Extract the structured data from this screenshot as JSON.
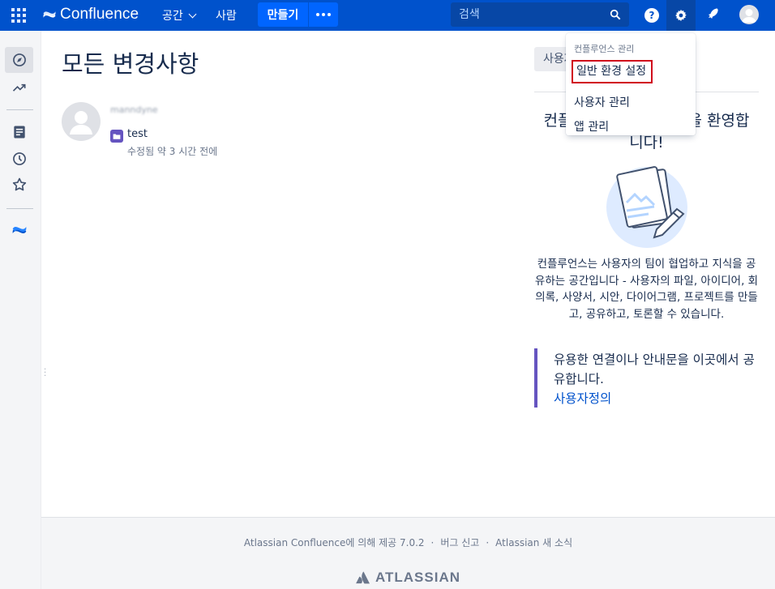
{
  "header": {
    "logo_text": "Confluence",
    "spaces_label": "공간",
    "people_label": "사람",
    "create_label": "만들기",
    "search_placeholder": "검색",
    "help_symbol": "?",
    "brand_color": "#0052cc"
  },
  "main": {
    "title": "모든 변경사항",
    "feed": [
      {
        "user": "manndyne",
        "page": "test",
        "meta": "수정됨 약 3 시간 전에"
      }
    ]
  },
  "right_panel": {
    "button_label": "사용자",
    "welcome_title": "컨플루언스 팀 스페이스에 오신 것을 환영합니다!",
    "welcome_visible_start": "컨플",
    "welcome_visible_end": "을 환영합",
    "welcome_line2": "니다!",
    "description": "컨플루언스는 사용자의 팀이 협업하고 지식을 공유하는 공간입니다 - 사용자의 파일, 아이디어, 회의록, 사양서, 시안, 다이어그램, 프로젝트를 만들고, 공유하고, 토론할 수 있습니다.",
    "info_text": "유용한 연결이나 안내문을 이곳에서 공유합니다.",
    "info_link": "사용자정의",
    "accent_color": "#6554c0"
  },
  "admin_menu": {
    "heading": "컨플루언스 관리",
    "items": [
      {
        "label": "일반 환경 설정",
        "highlighted": true
      },
      {
        "label": "사용자 관리",
        "highlighted": false
      },
      {
        "label": "앱 관리",
        "highlighted": false
      }
    ]
  },
  "sidebar": {
    "items": [
      "compass-icon",
      "chart-icon",
      "feed-icon",
      "clock-icon",
      "star-icon",
      "confluence-logo-icon"
    ]
  },
  "footer": {
    "powered_by": "Atlassian Confluence에 의해 제공 7.0.2",
    "report_bug": "버그 신고",
    "news": "Atlassian 새 소식",
    "separator": "·",
    "logo_text": "ATLASSIAN"
  }
}
